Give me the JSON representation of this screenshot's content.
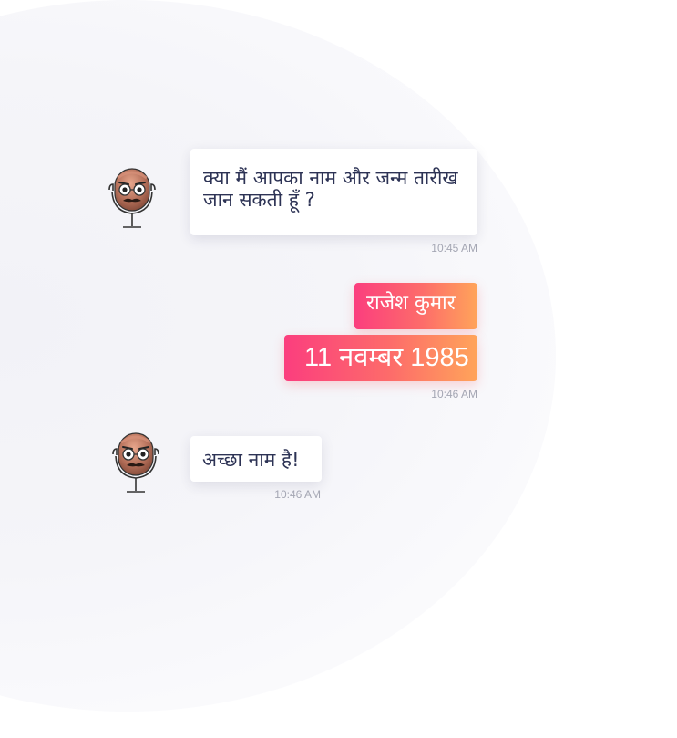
{
  "messages": [
    {
      "sender": "bot",
      "avatar_icon": "microphone-mascot-icon",
      "text": "क्या मैं आपका नाम और जन्म तारीख जान सकती हूँ ?",
      "time": "10:45 AM"
    },
    {
      "sender": "user",
      "bubbles": [
        "राजेश कुमार",
        "11 नवम्बर 1985"
      ],
      "time": "10:46 AM"
    },
    {
      "sender": "bot",
      "avatar_icon": "microphone-mascot-icon",
      "text": "अच्छा नाम है!",
      "time": "10:46 AM"
    }
  ],
  "colors": {
    "bot_text": "#2d3355",
    "gradient_start": "#fb3e7e",
    "gradient_end": "#ffa45a",
    "timestamp": "#a4a6b3"
  }
}
